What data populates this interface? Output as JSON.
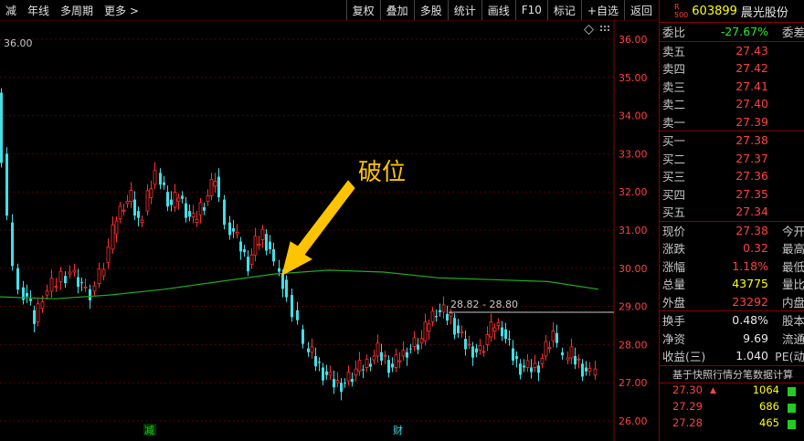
{
  "toolbar": {
    "left": [
      "减",
      "年线",
      "多周期",
      "更多 >"
    ],
    "right": [
      "复权",
      "叠加",
      "多股",
      "统计",
      "画线",
      "F10",
      "标记",
      "+自选",
      "返回"
    ]
  },
  "chart": {
    "top_label": "36.00",
    "price_axis": [
      "36.00",
      "35.00",
      "34.00",
      "33.00",
      "32.00",
      "31.00",
      "30.00",
      "29.00",
      "28.00",
      "27.00",
      "26.00"
    ],
    "annotation": "破位",
    "range_label": "28.82 - 28.80",
    "markers": [
      "减",
      "财"
    ],
    "colors": {
      "up": "#ff3030",
      "down": "#40e0e8",
      "ma": "#22aa22",
      "annotation": "#ffcc00"
    }
  },
  "quote": {
    "r_label": "R",
    "r_sub": "500",
    "code": "603899",
    "name": "晨光股份",
    "weibi_label": "委比",
    "weibi_value": "-27.67%",
    "weicha_label": "委差",
    "asks": [
      {
        "label": "卖五",
        "price": "27.43"
      },
      {
        "label": "卖四",
        "price": "27.42"
      },
      {
        "label": "卖三",
        "price": "27.41"
      },
      {
        "label": "卖二",
        "price": "27.40"
      },
      {
        "label": "卖一",
        "price": "27.39"
      }
    ],
    "bids": [
      {
        "label": "买一",
        "price": "27.38"
      },
      {
        "label": "买二",
        "price": "27.37"
      },
      {
        "label": "买三",
        "price": "27.36"
      },
      {
        "label": "买四",
        "price": "27.35"
      },
      {
        "label": "买五",
        "price": "27.34"
      }
    ],
    "stats1": [
      {
        "label": "现价",
        "value": "27.38",
        "label2": "今开"
      },
      {
        "label": "涨跌",
        "value": "0.32",
        "label2": "最高"
      },
      {
        "label": "涨幅",
        "value": "1.18%",
        "label2": "最低"
      },
      {
        "label": "总量",
        "value": "43775",
        "label2": "量比"
      },
      {
        "label": "外盘",
        "value": "23292",
        "label2": "内盘"
      }
    ],
    "stats2": [
      {
        "label": "换手",
        "value": "0.48%",
        "label2": "股本"
      },
      {
        "label": "净资",
        "value": "9.69",
        "label2": "流通"
      },
      {
        "label": "收益(三)",
        "value": "1.040",
        "label2": "PE(动"
      }
    ],
    "tick_title": "基于快照行情分笔数据计算",
    "ticks": [
      {
        "price": "27.30",
        "arrow": "▲",
        "vol": "1064"
      },
      {
        "price": "27.29",
        "arrow": "",
        "vol": "686"
      },
      {
        "price": "27.28",
        "arrow": "",
        "vol": "465"
      }
    ]
  }
}
